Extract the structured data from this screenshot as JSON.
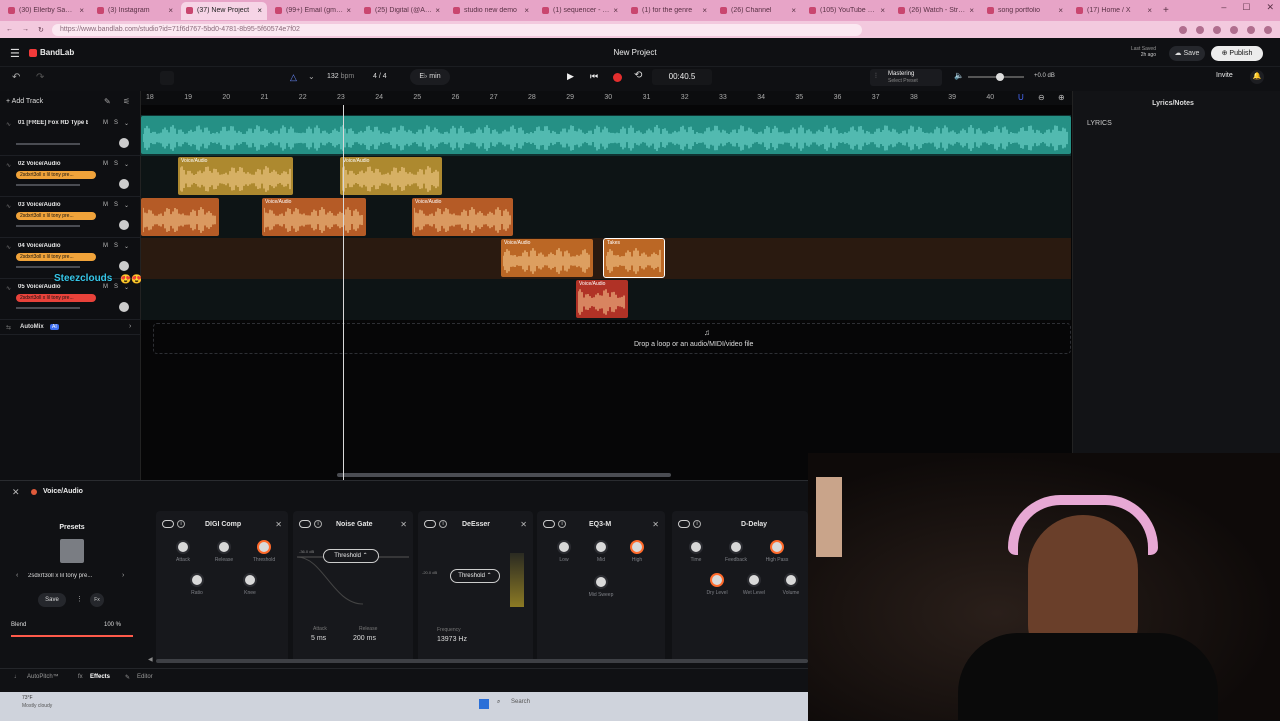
{
  "browser": {
    "tabs": [
      {
        "label": "(30) Ellerby Sample",
        "active": false
      },
      {
        "label": "(3) Instagram",
        "active": false
      },
      {
        "label": "(37) New Project",
        "active": true
      },
      {
        "label": "(99+) Email (gmail.com)",
        "active": false
      },
      {
        "label": "(25) Digital (@Anagrams)",
        "active": false
      },
      {
        "label": "studio new demo",
        "active": false
      },
      {
        "label": "(1) sequencer - Google",
        "active": false
      },
      {
        "label": "(1) for the genre",
        "active": false
      },
      {
        "label": "(26) Channel",
        "active": false
      },
      {
        "label": "(105) YouTube Music",
        "active": false
      },
      {
        "label": "(26) Watch - Stream",
        "active": false
      },
      {
        "label": "song portfolio",
        "active": false
      },
      {
        "label": "(17) Home / X",
        "active": false
      }
    ],
    "url": "https://www.bandlab.com/studio?id=71f6d767-5bd0-4781-8b95-5f60574e7f02"
  },
  "app": {
    "logo": "BandLab",
    "project_title": "New Project",
    "last_saved_line1": "Last Saved",
    "last_saved_line2": "2h ago",
    "save_label": "Save",
    "publish_label": "Publish",
    "invite_label": "Invite"
  },
  "transport": {
    "bpm": "132",
    "bpm_unit": "bpm",
    "time_signature": "4 / 4",
    "key": "E♭ min",
    "time": "00:40.5",
    "mastering_label": "Mastering",
    "mastering_sub": "Select Preset",
    "master_volume": "+0.0 dB",
    "add_track": "Add Track"
  },
  "ruler": [
    "18",
    "19",
    "20",
    "21",
    "22",
    "23",
    "24",
    "25",
    "26",
    "27",
    "28",
    "29",
    "30",
    "31",
    "32",
    "33",
    "34",
    "35",
    "36",
    "37",
    "38",
    "39",
    "40"
  ],
  "tracks": [
    {
      "name": "01 [FREE] Fox RD Type Beat",
      "fx": "",
      "color": "#2aa79b"
    },
    {
      "name": "02 Voice/Audio",
      "fx": "2sdxrt3oll x lil tony pre...",
      "color": "#d6a636"
    },
    {
      "name": "03 Voice/Audio",
      "fx": "2sdxrt3oll x lil tony pre...",
      "color": "#e06d2a"
    },
    {
      "name": "04 Voice/Audio",
      "fx": "2sdxrt3oll x lil tony pre...",
      "color": "#e07b2a"
    },
    {
      "name": "05 Voice/Audio",
      "fx": "2sdxrt3oll x lil tony pre...",
      "color": "#d93a2a"
    }
  ],
  "clips": {
    "voice": "Voice/Audio",
    "takes": "Takes"
  },
  "overlay_name": "Steezclouds",
  "automix": "AutoMix",
  "automix_badge": "AI",
  "drop_hint": "Drop a loop or an audio/MIDI/video file",
  "lyrics": {
    "panel_title": "Lyrics/Notes",
    "heading": "LYRICS"
  },
  "fx_panel": {
    "track": "Voice/Audio",
    "presets_title": "Presets",
    "preset_name": "2sdxrt3oll x lil tony pre...",
    "save": "Save",
    "fx_btn": "Fx",
    "blend_label": "Blend",
    "blend_value": "100 %",
    "blend": 1.0,
    "units": [
      {
        "name": "DIGI Comp",
        "knobs": [
          "Attack",
          "Release",
          "Threshold",
          "Ratio",
          "Knee"
        ]
      },
      {
        "name": "Noise Gate",
        "threshold": "Threshold",
        "top_db": "-36.0 dB",
        "attack_label": "Attack",
        "attack": "5 ms",
        "release_label": "Release",
        "release": "200 ms"
      },
      {
        "name": "DeEsser",
        "threshold": "Threshold",
        "db": "-20.0 dB",
        "freq_label": "Frequency",
        "freq": "13973 Hz"
      },
      {
        "name": "EQ3-M",
        "knobs": [
          "Low",
          "Mid",
          "High",
          "Mid Sweep"
        ]
      },
      {
        "name": "D-Delay",
        "knobs": [
          "Time",
          "Feedback",
          "High Pass",
          "Dry Level",
          "Wet Level",
          "Volume"
        ]
      }
    ],
    "tabs": [
      "AutoPitch™",
      "Effects",
      "Editor"
    ]
  },
  "weather": {
    "temp": "73°F",
    "desc": "Mostly cloudy"
  },
  "taskbar_search": "Search"
}
